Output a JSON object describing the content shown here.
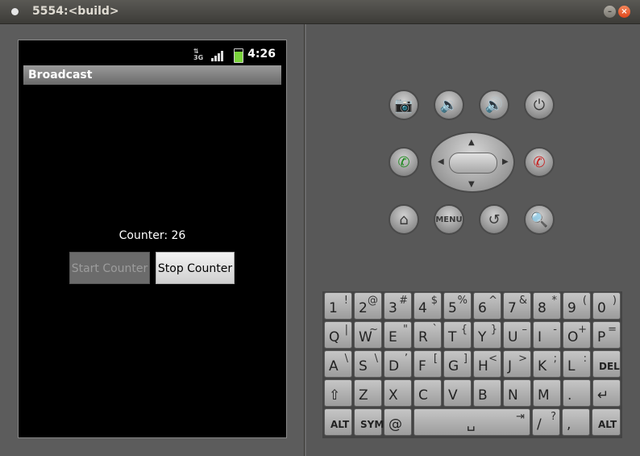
{
  "window": {
    "title": "5554:<build>"
  },
  "device": {
    "status_time": "4:26",
    "network": "3G",
    "app_title": "Broadcast",
    "counter_text": "Counter: 26",
    "start_label": "Start Counter",
    "stop_label": "Stop Counter"
  },
  "hardware": {
    "camera": "camera-icon",
    "vol_down": "volume-down-icon",
    "vol_up": "volume-up-icon",
    "power": "power-icon",
    "call": "call-icon",
    "end_call": "end-call-icon",
    "home": "home-icon",
    "menu_label": "MENU",
    "back": "back-icon",
    "search": "search-icon"
  },
  "keyboard": {
    "row1": [
      [
        "1",
        "!"
      ],
      [
        "2",
        "@"
      ],
      [
        "3",
        "#"
      ],
      [
        "4",
        "$"
      ],
      [
        "5",
        "%"
      ],
      [
        "6",
        "^"
      ],
      [
        "7",
        "&"
      ],
      [
        "8",
        "*"
      ],
      [
        "9",
        "("
      ],
      [
        "0",
        ")"
      ]
    ],
    "row2": [
      [
        "Q",
        "|"
      ],
      [
        "W",
        "~"
      ],
      [
        "E",
        "\""
      ],
      [
        "R",
        "`"
      ],
      [
        "T",
        "{"
      ],
      [
        "Y",
        "}"
      ],
      [
        "U",
        "–"
      ],
      [
        "I",
        "-"
      ],
      [
        "O",
        "+"
      ],
      [
        "P",
        "="
      ]
    ],
    "row3": [
      [
        "A",
        "\\"
      ],
      [
        "S",
        "\\"
      ],
      [
        "D",
        "’"
      ],
      [
        "F",
        "["
      ],
      [
        "G",
        "]"
      ],
      [
        "H",
        "<"
      ],
      [
        "J",
        ">"
      ],
      [
        "K",
        ";"
      ],
      [
        "L",
        ":"
      ],
      [
        "DEL",
        ""
      ]
    ],
    "row4": [
      [
        "⇧",
        ""
      ],
      [
        "Z",
        ""
      ],
      [
        "X",
        ""
      ],
      [
        "C",
        ""
      ],
      [
        "V",
        ""
      ],
      [
        "B",
        ""
      ],
      [
        "N",
        ""
      ],
      [
        "M",
        ""
      ],
      [
        ".",
        ""
      ],
      [
        "↵",
        ""
      ]
    ],
    "row5": {
      "alt_left": "ALT",
      "sym": "SYM",
      "at": "@",
      "slash": "/",
      "question": "?",
      "comma": ",",
      "alt_right": "ALT"
    }
  }
}
